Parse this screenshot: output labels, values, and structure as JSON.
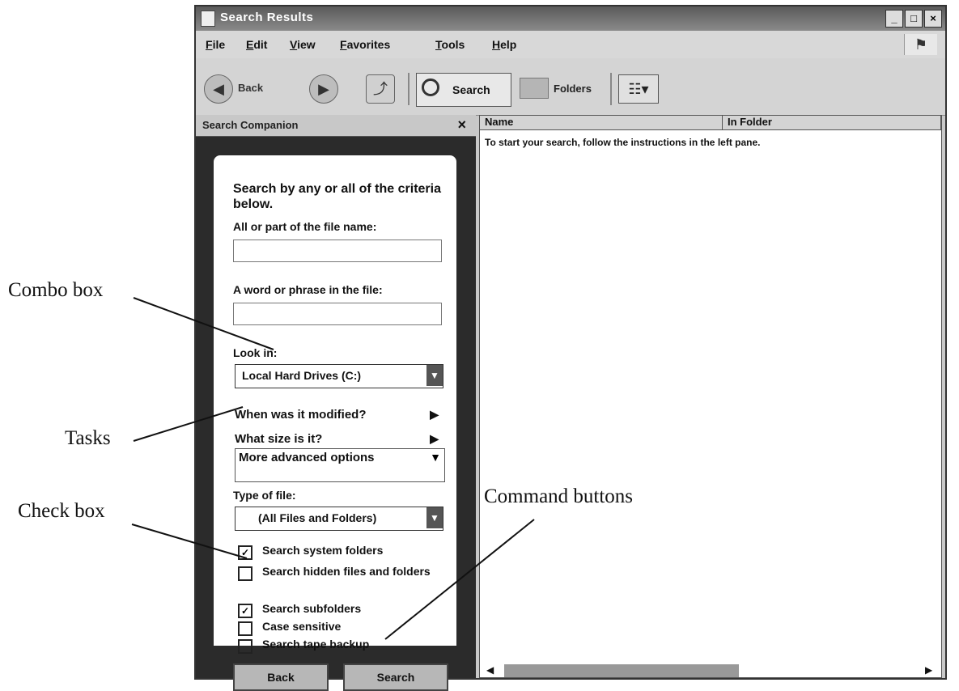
{
  "window": {
    "title": "Search Results",
    "controls": [
      "_",
      "□",
      "×"
    ]
  },
  "menu": {
    "items": [
      "File",
      "Edit",
      "View",
      "Favorites",
      "Tools",
      "Help"
    ]
  },
  "toolbar": {
    "back": "Back",
    "search": "Search",
    "folders": "Folders"
  },
  "left_pane": {
    "title": "Search Companion",
    "close": "×",
    "heading": "Search by any or all of the criteria below.",
    "file_name_label": "All or part of the file name:",
    "file_name_value": "",
    "phrase_label": "A word or phrase in the file:",
    "phrase_value": "",
    "look_in_label": "Look in:",
    "look_in_value": "Local Hard Drives (C:)",
    "task_modified": "When was it modified?",
    "task_size": "What size is it?",
    "more_advanced": "More advanced options",
    "type_label": "Type of file:",
    "type_value": "(All Files and Folders)",
    "checks": [
      {
        "label": "Search system folders",
        "checked": true
      },
      {
        "label": "Search hidden files and folders",
        "checked": false
      },
      {
        "label": "Search subfolders",
        "checked": true
      },
      {
        "label": "Case sensitive",
        "checked": false
      },
      {
        "label": "Search tape backup",
        "checked": false
      }
    ],
    "back_button": "Back",
    "search_button": "Search"
  },
  "right_pane": {
    "columns": [
      "Name",
      "In Folder"
    ],
    "instructions": "To start your search, follow the instructions in the left pane."
  },
  "callouts": {
    "combo_box": "Combo box",
    "tasks": "Tasks",
    "check_box": "Check box",
    "command_buttons": "Command buttons"
  },
  "icons": [
    "window-icon",
    "back-arrow-icon",
    "forward-arrow-icon",
    "up-folder-icon",
    "search-icon",
    "folders-icon",
    "views-icon",
    "windows-flag-icon",
    "close-icon",
    "dropdown-arrow-icon",
    "expand-arrow-icon",
    "collapse-arrow-icon",
    "checkbox-icon"
  ]
}
